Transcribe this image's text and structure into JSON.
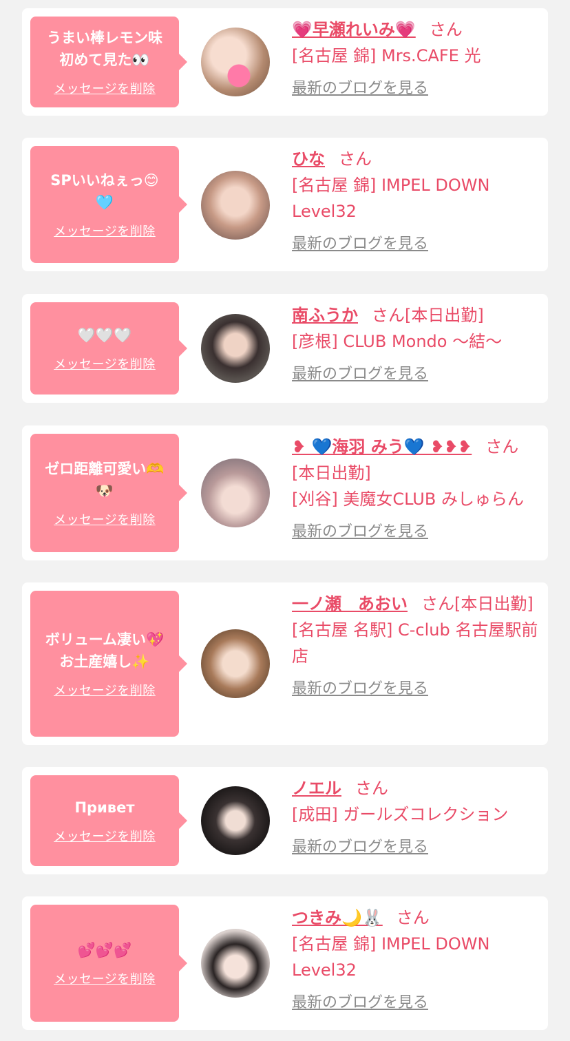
{
  "colors": {
    "bubble": "#ff909f",
    "accent": "#e94b67",
    "link_gray": "#8a8a8a",
    "bg": "#f2f2f2"
  },
  "delete_label": "メッセージを削除",
  "blog_label": "最新のブログを見る",
  "suffix": "さん",
  "cards": [
    {
      "message": "うまい棒レモン味\n初めて見た👀",
      "name": "💗早瀬れいみ💗",
      "after_name": "",
      "shop": "[名古屋 錦] Mrs.CAFE 光"
    },
    {
      "message": "SPいいねぇっ😊\n🩵",
      "name": "ひな",
      "after_name": "",
      "shop": "[名古屋 錦] IMPEL DOWN Level32"
    },
    {
      "message": "🤍🤍🤍",
      "name": "南ふうか",
      "after_name": "[本日出勤]",
      "shop": "[彦根] CLUB Mondo 〜結〜"
    },
    {
      "message": "ゼロ距離可愛い🫶\n🐶",
      "name": "❥ 💙海羽 みう💙 ❥❥❥",
      "after_name": "[本日出勤]",
      "shop": "[刈谷] 美魔女CLUB みしゅらん"
    },
    {
      "message": "ボリューム凄い💖\nお土産嬉し✨",
      "name": "一ノ瀬　あおい",
      "after_name": "[本日出勤]",
      "shop": "[名古屋 名駅] C-club 名古屋駅前店"
    },
    {
      "message": "Привет",
      "name": "ノエル",
      "after_name": "",
      "shop": "[成田] ガールズコレクション"
    },
    {
      "message": "💕💕💕",
      "name": "つきみ🌙🐰",
      "after_name": "",
      "shop": "[名古屋 錦] IMPEL DOWN Level32"
    }
  ]
}
